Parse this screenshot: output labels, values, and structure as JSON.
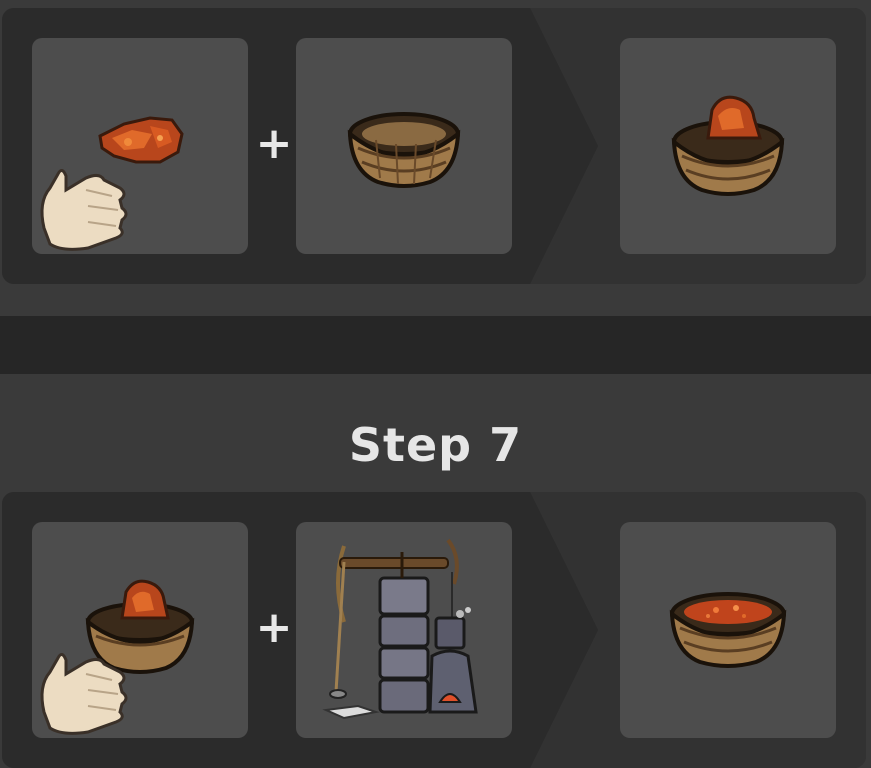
{
  "recipes": [
    {
      "plus_symbol": "+",
      "inputs": [
        {
          "icon": "hand-holding-red-clay-icon"
        },
        {
          "icon": "woven-basket-icon"
        }
      ],
      "output": {
        "icon": "basket-with-red-clay-icon"
      }
    },
    {
      "title": "Step 7",
      "plus_symbol": "+",
      "inputs": [
        {
          "icon": "hand-holding-basket-of-clay-icon"
        },
        {
          "icon": "kiln-with-bow-drill-icon"
        }
      ],
      "output": {
        "icon": "basket-of-crushed-clay-icon"
      }
    }
  ],
  "colors": {
    "background": "#3a3a3a",
    "panel": "#2e2e2e",
    "slot": "#4d4d4d",
    "divider": "#262626",
    "text": "#e6e6e6"
  }
}
